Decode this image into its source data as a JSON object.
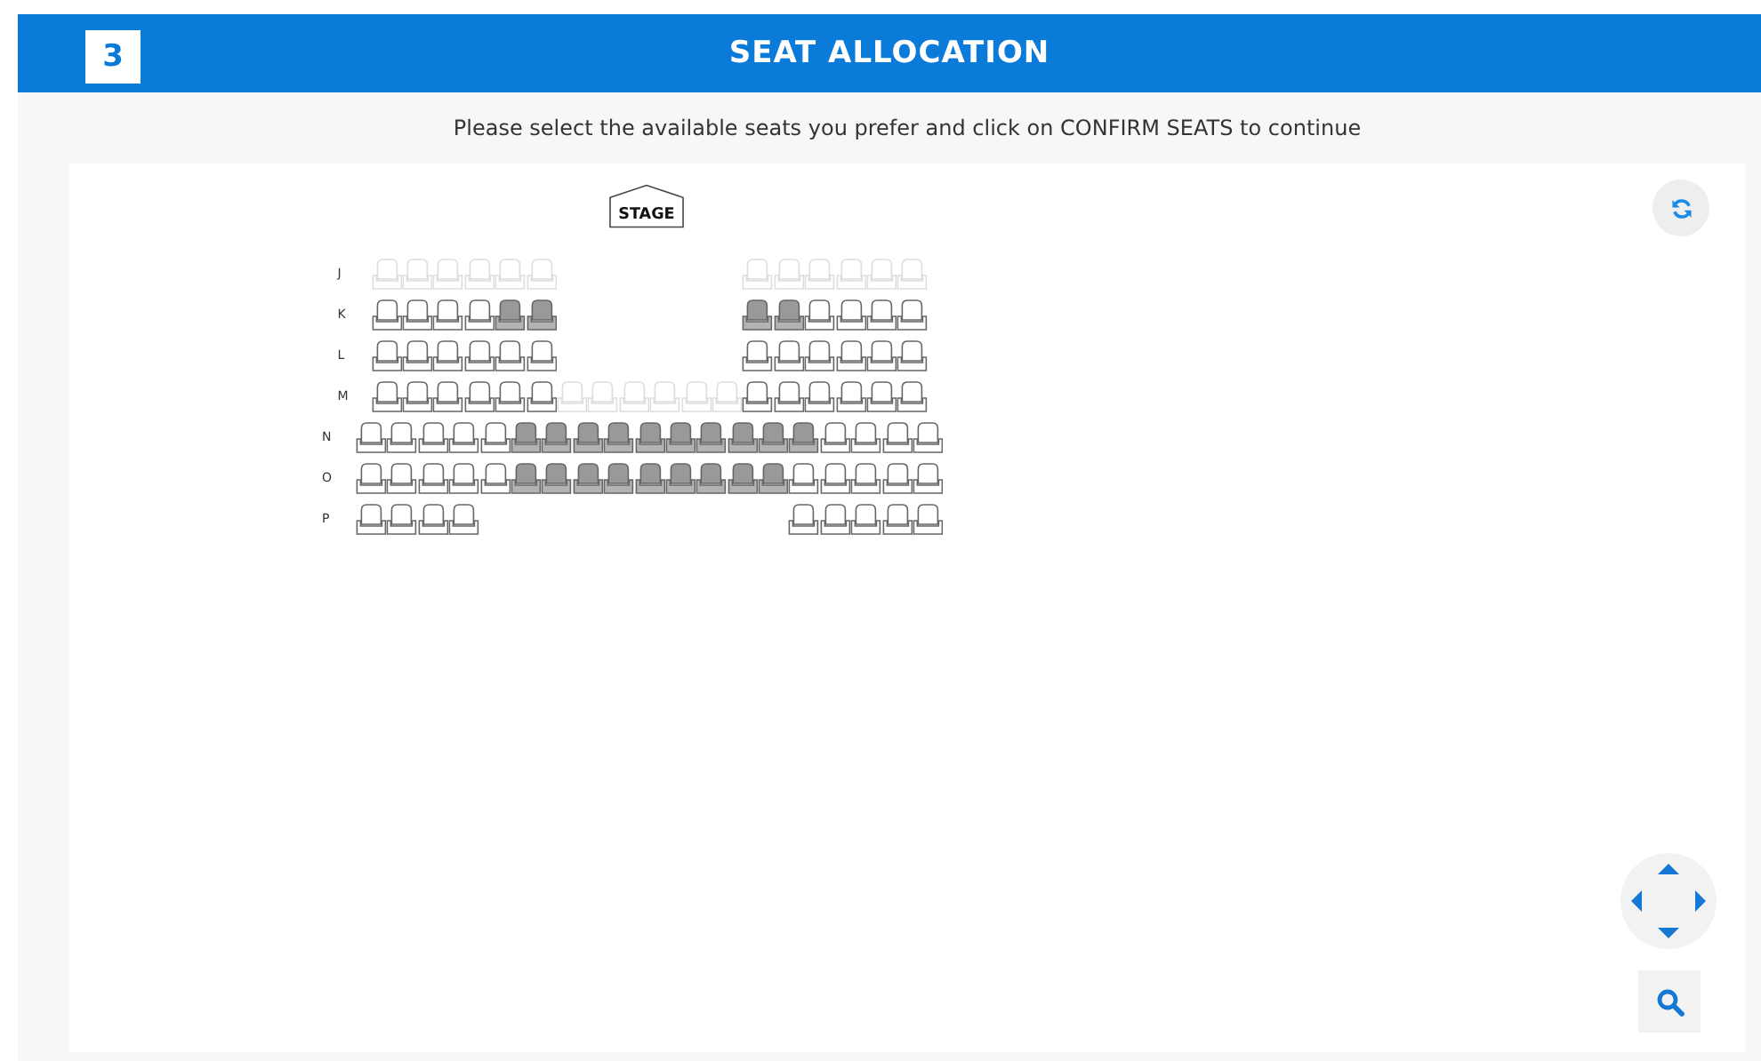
{
  "header": {
    "step": "3",
    "title": "SEAT ALLOCATION"
  },
  "instruction": "Please select the available seats you prefer and click on CONFIRM SEATS to continue",
  "stage": {
    "label": "STAGE"
  },
  "rows": [
    {
      "label": "J",
      "seats": [
        {
          "kind": "seat",
          "occupied": false,
          "disabled": true
        },
        {
          "kind": "seat",
          "occupied": false,
          "disabled": true
        },
        {
          "kind": "seat",
          "occupied": false,
          "disabled": true
        },
        {
          "kind": "seat",
          "occupied": false,
          "disabled": true
        },
        {
          "kind": "seat",
          "occupied": false,
          "disabled": true
        },
        {
          "kind": "seat",
          "occupied": false,
          "disabled": true
        },
        {
          "kind": "gap"
        },
        {
          "kind": "gap"
        },
        {
          "kind": "gap"
        },
        {
          "kind": "gap"
        },
        {
          "kind": "gap"
        },
        {
          "kind": "gap"
        },
        {
          "kind": "seat",
          "occupied": false,
          "disabled": true
        },
        {
          "kind": "seat",
          "occupied": false,
          "disabled": true
        },
        {
          "kind": "seat",
          "occupied": false,
          "disabled": true
        },
        {
          "kind": "seat",
          "occupied": false,
          "disabled": true
        },
        {
          "kind": "seat",
          "occupied": false,
          "disabled": true
        },
        {
          "kind": "seat",
          "occupied": false,
          "disabled": true
        }
      ]
    },
    {
      "label": "K",
      "seats": [
        {
          "kind": "seat",
          "occupied": false,
          "disabled": false
        },
        {
          "kind": "seat",
          "occupied": false,
          "disabled": false
        },
        {
          "kind": "seat",
          "occupied": false,
          "disabled": false
        },
        {
          "kind": "seat",
          "occupied": false,
          "disabled": false
        },
        {
          "kind": "seat",
          "occupied": true,
          "disabled": false
        },
        {
          "kind": "seat",
          "occupied": true,
          "disabled": false
        },
        {
          "kind": "gap"
        },
        {
          "kind": "gap"
        },
        {
          "kind": "gap"
        },
        {
          "kind": "gap"
        },
        {
          "kind": "gap"
        },
        {
          "kind": "gap"
        },
        {
          "kind": "seat",
          "occupied": true,
          "disabled": false
        },
        {
          "kind": "seat",
          "occupied": true,
          "disabled": false
        },
        {
          "kind": "seat",
          "occupied": false,
          "disabled": false
        },
        {
          "kind": "seat",
          "occupied": false,
          "disabled": false
        },
        {
          "kind": "seat",
          "occupied": false,
          "disabled": false
        },
        {
          "kind": "seat",
          "occupied": false,
          "disabled": false
        }
      ]
    },
    {
      "label": "L",
      "seats": [
        {
          "kind": "seat",
          "occupied": false,
          "disabled": false
        },
        {
          "kind": "seat",
          "occupied": false,
          "disabled": false
        },
        {
          "kind": "seat",
          "occupied": false,
          "disabled": false
        },
        {
          "kind": "seat",
          "occupied": false,
          "disabled": false
        },
        {
          "kind": "seat",
          "occupied": false,
          "disabled": false
        },
        {
          "kind": "seat",
          "occupied": false,
          "disabled": false
        },
        {
          "kind": "gap"
        },
        {
          "kind": "gap"
        },
        {
          "kind": "gap"
        },
        {
          "kind": "gap"
        },
        {
          "kind": "gap"
        },
        {
          "kind": "gap"
        },
        {
          "kind": "seat",
          "occupied": false,
          "disabled": false
        },
        {
          "kind": "seat",
          "occupied": false,
          "disabled": false
        },
        {
          "kind": "seat",
          "occupied": false,
          "disabled": false
        },
        {
          "kind": "seat",
          "occupied": false,
          "disabled": false
        },
        {
          "kind": "seat",
          "occupied": false,
          "disabled": false
        },
        {
          "kind": "seat",
          "occupied": false,
          "disabled": false
        }
      ]
    },
    {
      "label": "M",
      "seats": [
        {
          "kind": "seat",
          "occupied": false,
          "disabled": false
        },
        {
          "kind": "seat",
          "occupied": false,
          "disabled": false
        },
        {
          "kind": "seat",
          "occupied": false,
          "disabled": false
        },
        {
          "kind": "seat",
          "occupied": false,
          "disabled": false
        },
        {
          "kind": "seat",
          "occupied": false,
          "disabled": false
        },
        {
          "kind": "seat",
          "occupied": false,
          "disabled": false
        },
        {
          "kind": "seat",
          "occupied": false,
          "disabled": true
        },
        {
          "kind": "seat",
          "occupied": false,
          "disabled": true
        },
        {
          "kind": "seat",
          "occupied": false,
          "disabled": true
        },
        {
          "kind": "seat",
          "occupied": false,
          "disabled": true
        },
        {
          "kind": "seat",
          "occupied": false,
          "disabled": true
        },
        {
          "kind": "seat",
          "occupied": false,
          "disabled": true
        },
        {
          "kind": "seat",
          "occupied": false,
          "disabled": false
        },
        {
          "kind": "seat",
          "occupied": false,
          "disabled": false
        },
        {
          "kind": "seat",
          "occupied": false,
          "disabled": false
        },
        {
          "kind": "seat",
          "occupied": false,
          "disabled": false
        },
        {
          "kind": "seat",
          "occupied": false,
          "disabled": false
        },
        {
          "kind": "seat",
          "occupied": false,
          "disabled": false
        }
      ]
    },
    {
      "label": "N",
      "seats": [
        {
          "kind": "seat",
          "occupied": false,
          "disabled": false
        },
        {
          "kind": "seat",
          "occupied": false,
          "disabled": false
        },
        {
          "kind": "seat",
          "occupied": false,
          "disabled": false
        },
        {
          "kind": "seat",
          "occupied": false,
          "disabled": false
        },
        {
          "kind": "seat",
          "occupied": false,
          "disabled": false
        },
        {
          "kind": "seat",
          "occupied": true,
          "disabled": false
        },
        {
          "kind": "seat",
          "occupied": true,
          "disabled": false
        },
        {
          "kind": "seat",
          "occupied": true,
          "disabled": false
        },
        {
          "kind": "seat",
          "occupied": true,
          "disabled": false
        },
        {
          "kind": "seat",
          "occupied": true,
          "disabled": false
        },
        {
          "kind": "seat",
          "occupied": true,
          "disabled": false
        },
        {
          "kind": "seat",
          "occupied": true,
          "disabled": false
        },
        {
          "kind": "seat",
          "occupied": true,
          "disabled": false
        },
        {
          "kind": "seat",
          "occupied": true,
          "disabled": false
        },
        {
          "kind": "seat",
          "occupied": true,
          "disabled": false
        },
        {
          "kind": "seat",
          "occupied": false,
          "disabled": false
        },
        {
          "kind": "seat",
          "occupied": false,
          "disabled": false
        },
        {
          "kind": "seat",
          "occupied": false,
          "disabled": false
        },
        {
          "kind": "seat",
          "occupied": false,
          "disabled": false
        }
      ]
    },
    {
      "label": "O",
      "seats": [
        {
          "kind": "seat",
          "occupied": false,
          "disabled": false
        },
        {
          "kind": "seat",
          "occupied": false,
          "disabled": false
        },
        {
          "kind": "seat",
          "occupied": false,
          "disabled": false
        },
        {
          "kind": "seat",
          "occupied": false,
          "disabled": false
        },
        {
          "kind": "seat",
          "occupied": false,
          "disabled": false
        },
        {
          "kind": "seat",
          "occupied": true,
          "disabled": false
        },
        {
          "kind": "seat",
          "occupied": true,
          "disabled": false
        },
        {
          "kind": "seat",
          "occupied": true,
          "disabled": false
        },
        {
          "kind": "seat",
          "occupied": true,
          "disabled": false
        },
        {
          "kind": "seat",
          "occupied": true,
          "disabled": false
        },
        {
          "kind": "seat",
          "occupied": true,
          "disabled": false
        },
        {
          "kind": "seat",
          "occupied": true,
          "disabled": false
        },
        {
          "kind": "seat",
          "occupied": true,
          "disabled": false
        },
        {
          "kind": "seat",
          "occupied": true,
          "disabled": false
        },
        {
          "kind": "seat",
          "occupied": false,
          "disabled": false
        },
        {
          "kind": "seat",
          "occupied": false,
          "disabled": false
        },
        {
          "kind": "seat",
          "occupied": false,
          "disabled": false
        },
        {
          "kind": "seat",
          "occupied": false,
          "disabled": false
        },
        {
          "kind": "seat",
          "occupied": false,
          "disabled": false
        }
      ]
    },
    {
      "label": "P",
      "seats": [
        {
          "kind": "seat",
          "occupied": false,
          "disabled": false
        },
        {
          "kind": "seat",
          "occupied": false,
          "disabled": false
        },
        {
          "kind": "seat",
          "occupied": false,
          "disabled": false
        },
        {
          "kind": "seat",
          "occupied": false,
          "disabled": false
        },
        {
          "kind": "gap"
        },
        {
          "kind": "gap"
        },
        {
          "kind": "gap"
        },
        {
          "kind": "gap"
        },
        {
          "kind": "gap"
        },
        {
          "kind": "gap"
        },
        {
          "kind": "gap"
        },
        {
          "kind": "gap"
        },
        {
          "kind": "gap"
        },
        {
          "kind": "gap"
        },
        {
          "kind": "seat",
          "occupied": false,
          "disabled": false
        },
        {
          "kind": "seat",
          "occupied": false,
          "disabled": false
        },
        {
          "kind": "seat",
          "occupied": false,
          "disabled": false
        },
        {
          "kind": "seat",
          "occupied": false,
          "disabled": false
        },
        {
          "kind": "seat",
          "occupied": false,
          "disabled": false
        }
      ]
    }
  ]
}
